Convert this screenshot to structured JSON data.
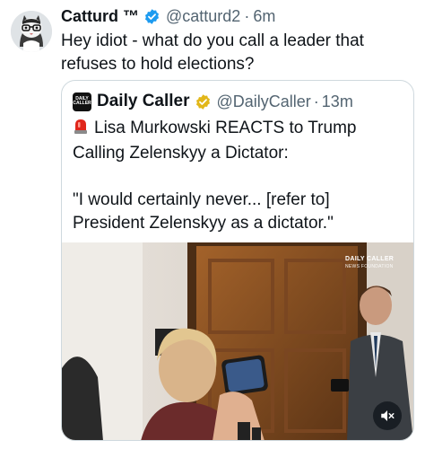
{
  "tweet": {
    "author_name": "Catturd ™",
    "handle": "@catturd2",
    "separator": "·",
    "time": "6m",
    "text": "Hey idiot - what do you call a leader that refuses to hold elections?"
  },
  "quote": {
    "author_name": "Daily Caller",
    "handle": "@DailyCaller",
    "separator": "·",
    "time": "13m",
    "avatar_text": [
      "DAILY",
      "CALLER"
    ],
    "text": "Lisa Murkowski REACTS to Trump Calling Zelenskyy a Dictator:\n\n\"I would certainly never... [refer to] President Zelenskyy as a dictator.\"",
    "media": {
      "watermark_title": "DAILY CALLER",
      "watermark_sub": "NEWS FOUNDATION",
      "mute_icon": "speaker-muted-icon"
    }
  },
  "colors": {
    "verified_blue": "#1d9bf0",
    "verified_gold": "#e2b719",
    "text_primary": "#0f1419",
    "text_secondary": "#536471",
    "border": "#cfd9de",
    "siren_red": "#e0261b"
  }
}
